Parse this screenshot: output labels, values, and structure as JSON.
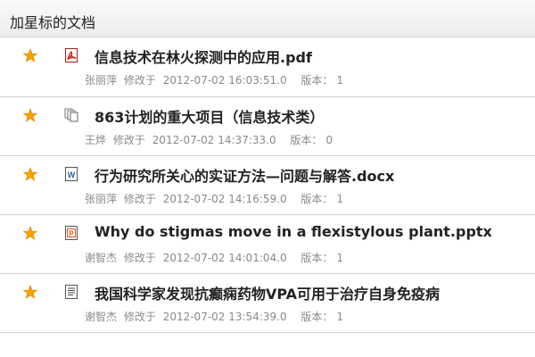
{
  "header": {
    "title": "加星标的文档"
  },
  "documents": [
    {
      "icon": "pdf-icon",
      "title": "信息技术在林火探测中的应用.pdf",
      "author": "张丽萍",
      "modified_label": "修改于",
      "modified_at": "2012-07-02 16:03:51.0",
      "version_label": "版本：",
      "version": "1"
    },
    {
      "icon": "multi-doc-icon",
      "title": "863计划的重大项目（信息技术类）",
      "author": "王烨",
      "modified_label": "修改于",
      "modified_at": "2012-07-02 14:37:33.0",
      "version_label": "版本：",
      "version": "0"
    },
    {
      "icon": "word-doc-icon",
      "title": "行为研究所关心的实证方法—问题与解答.docx",
      "author": "张丽萍",
      "modified_label": "修改于",
      "modified_at": "2012-07-02 14:16:59.0",
      "version_label": "版本：",
      "version": "1"
    },
    {
      "icon": "ppt-icon",
      "title": "Why do stigmas move in a flexistylous plant.pptx",
      "author": "谢智杰",
      "modified_label": "修改于",
      "modified_at": "2012-07-02 14:01:04.0",
      "version_label": "版本：",
      "version": "1"
    },
    {
      "icon": "text-doc-icon",
      "title": "我国科学家发现抗癫痫药物VPA可用于治疗自身免疫病",
      "author": "谢智杰",
      "modified_label": "修改于",
      "modified_at": "2012-07-02 13:54:39.0",
      "version_label": "版本：",
      "version": "1"
    }
  ],
  "colors": {
    "star": "#f5a300",
    "pdf": "#d12a1f",
    "ppt": "#d8531c",
    "word": "#2b5ca8"
  }
}
